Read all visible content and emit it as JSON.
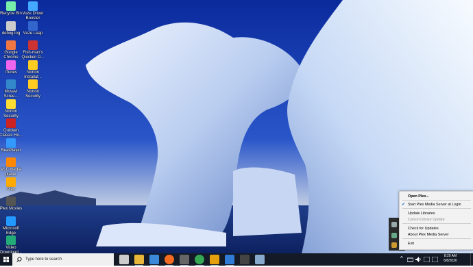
{
  "desktop": {
    "icons": [
      {
        "label": "Recycle Bin",
        "icon": "recycle-bin-icon"
      },
      {
        "label": "Vuze Driver Booster",
        "icon": "vuze-icon"
      },
      {
        "label": "debug.log",
        "icon": "text-file-icon"
      },
      {
        "label": "Vuze Leap",
        "icon": "vuze-leap-icon"
      },
      {
        "label": "Google Chrome",
        "icon": "chrome-icon"
      },
      {
        "label": "Fish-man's Quicken D...",
        "icon": "quicken-icon"
      },
      {
        "label": "iTunes",
        "icon": "itunes-icon"
      },
      {
        "label": "Norton Installat...",
        "icon": "norton-icon"
      },
      {
        "label": "Movavi Scree...",
        "icon": "movavi-icon"
      },
      {
        "label": "Norton Security",
        "icon": "norton-security-icon"
      },
      {
        "label": "Norton Security Scan",
        "icon": "norton-scan-icon"
      },
      {
        "label": "Quicken Classic Ho...",
        "icon": "quicken-classic-icon"
      },
      {
        "label": "RealPlayer",
        "icon": "realplayer-icon"
      },
      {
        "label": "VLC media player",
        "icon": "vlc-icon"
      },
      {
        "label": "Plex",
        "icon": "plex-icon"
      },
      {
        "label": "Plex Movies",
        "icon": "plex-movies-icon"
      },
      {
        "label": "Microsoft Edge",
        "icon": "edge-icon"
      },
      {
        "label": "Video Download...",
        "icon": "video-download-icon"
      }
    ]
  },
  "context_menu": {
    "items": [
      {
        "label": "Open Plex...",
        "bold": true,
        "checked": false,
        "disabled": false
      },
      {
        "label": "Start Plex Media Server at Login",
        "bold": false,
        "checked": true,
        "disabled": false
      },
      {
        "label": "Update Libraries",
        "bold": false,
        "checked": false,
        "disabled": false
      },
      {
        "label": "Cancel Library Update",
        "bold": false,
        "checked": false,
        "disabled": true
      },
      {
        "label": "Check for Updates",
        "bold": false,
        "checked": false,
        "disabled": false
      },
      {
        "label": "About Plex Media Server",
        "bold": false,
        "checked": false,
        "disabled": false
      },
      {
        "label": "Exit",
        "bold": false,
        "checked": false,
        "disabled": false
      }
    ],
    "check_glyph": "✔"
  },
  "taskbar": {
    "search_placeholder": "Type here to search",
    "apps": [
      "task-view-icon",
      "file-explorer-icon",
      "store-icon",
      "firefox-icon",
      "camera-icon",
      "chrome-icon",
      "plex-icon",
      "mail-icon",
      "terminal-icon",
      "photos-icon"
    ],
    "tray_chevron": "^",
    "clock_time": "8:29 AM",
    "clock_date": "6/8/2020"
  },
  "colors": {
    "taskbar_bg": "#141a26",
    "menu_bg": "#f2f2f2",
    "check_accent": "#1e64c8"
  }
}
